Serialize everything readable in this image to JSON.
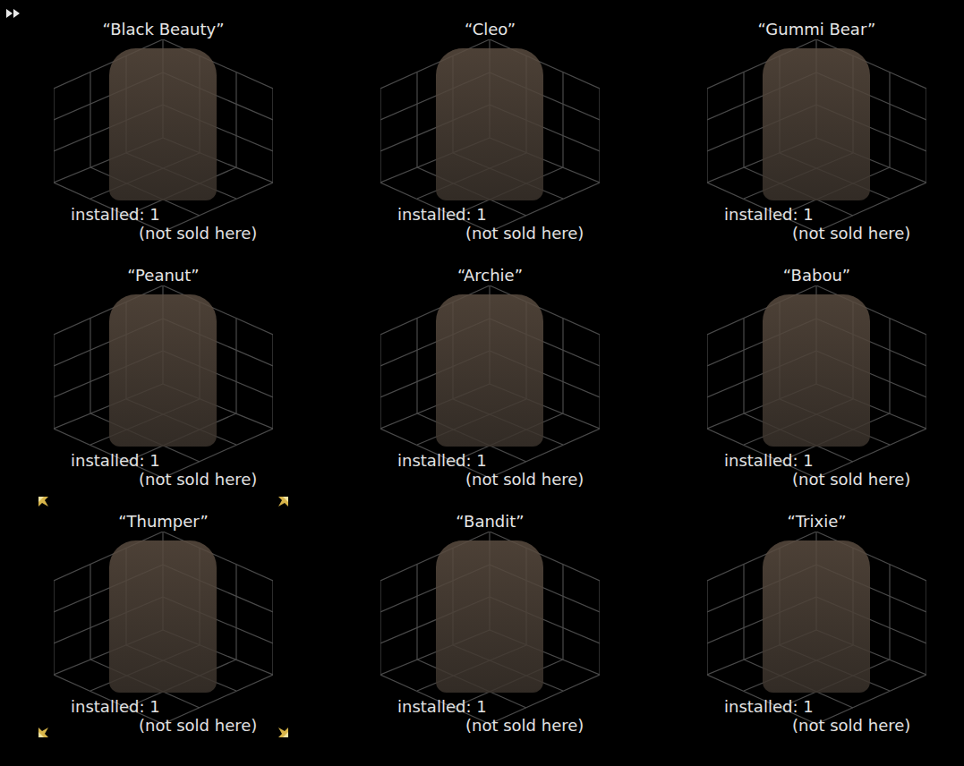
{
  "items": [
    {
      "name": "“Black Beauty”",
      "installed": "installed: 1",
      "note": "(not sold here)",
      "selected": false
    },
    {
      "name": "“Cleo”",
      "installed": "installed: 1",
      "note": "(not sold here)",
      "selected": false
    },
    {
      "name": "“Gummi Bear”",
      "installed": "installed: 1",
      "note": "(not sold here)",
      "selected": false
    },
    {
      "name": "“Peanut”",
      "installed": "installed: 1",
      "note": "(not sold here)",
      "selected": false
    },
    {
      "name": "“Archie”",
      "installed": "installed: 1",
      "note": "(not sold here)",
      "selected": false
    },
    {
      "name": "“Babou”",
      "installed": "installed: 1",
      "note": "(not sold here)",
      "selected": false
    },
    {
      "name": "“Thumper”",
      "installed": "installed: 1",
      "note": "(not sold here)",
      "selected": true
    },
    {
      "name": "“Bandit”",
      "installed": "installed: 1",
      "note": "(not sold here)",
      "selected": false
    },
    {
      "name": "“Trixie”",
      "installed": "installed: 1",
      "note": "(not sold here)",
      "selected": false
    }
  ]
}
